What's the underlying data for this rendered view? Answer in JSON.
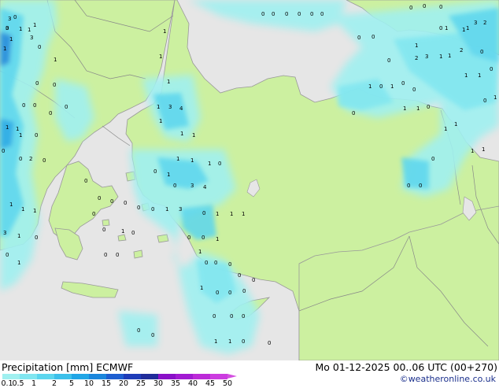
{
  "title": "Precipitation [mm] ECMWF",
  "valid_time": "Mo 01-12-2025 00..06 UTC (00+270)",
  "credit": "©weatheronline.co.uk",
  "legend": {
    "ticks": [
      "0.1",
      "0.5",
      "1",
      "2",
      "5",
      "10",
      "15",
      "20",
      "25",
      "30",
      "35",
      "40",
      "45",
      "50"
    ],
    "colors": [
      "#a0f0f0",
      "#80e6f0",
      "#5cd6ee",
      "#3cc0ea",
      "#20a6e6",
      "#1a86dc",
      "#1d5ed0",
      "#1e3cb8",
      "#202c9a",
      "#8a10c8",
      "#a21ad2",
      "#bc2ad8",
      "#cc3ce0"
    ]
  },
  "map": {
    "land_color": "#ccf0a0",
    "sea_color": "#e6e6e6",
    "coast_color": "#999999",
    "values": [
      "3",
      "1",
      "1",
      "1",
      "1",
      "3",
      "1",
      "0",
      "0",
      "0",
      "0",
      "0",
      "0",
      "0",
      "0",
      "0",
      "0",
      "0",
      "0",
      "1",
      "3",
      "2",
      "1",
      "1",
      "1",
      "0",
      "1",
      "2",
      "3",
      "1",
      "1",
      "2",
      "0",
      "1",
      "1",
      "0",
      "0",
      "1",
      "0",
      "1",
      "0",
      "0",
      "0",
      "0",
      "0",
      "0",
      "0",
      "3",
      "1",
      "1",
      "1",
      "0",
      "0",
      "0",
      "2",
      "0",
      "1",
      "1",
      "1",
      "3",
      "4",
      "1",
      "1",
      "1",
      "1",
      "1",
      "1",
      "0",
      "0",
      "3",
      "4",
      "1",
      "0",
      "0",
      "1",
      "1",
      "1",
      "0",
      "0",
      "1",
      "1",
      "0",
      "0",
      "0",
      "0",
      "1",
      "0",
      "0",
      "0",
      "0",
      "0",
      "0",
      "0",
      "1",
      "1",
      "0",
      "0",
      "0",
      "0",
      "1",
      "0",
      "1",
      "0",
      "0",
      "1",
      "1",
      "0",
      "1",
      "1",
      "1",
      "1",
      "0",
      "0",
      "0",
      "0",
      "1",
      "1",
      "1",
      "3",
      "1",
      "0",
      "0",
      "1",
      "0",
      "0",
      "0",
      "0",
      "0",
      "0",
      "1",
      "3",
      "0",
      "0",
      "1",
      "0",
      "0",
      "0",
      "0"
    ]
  }
}
